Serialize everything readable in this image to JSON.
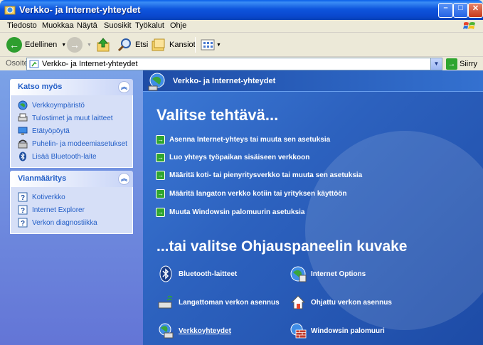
{
  "window": {
    "title": "Verkko- ja Internet-yhteydet"
  },
  "menu": [
    "Tiedosto",
    "Muokkaa",
    "Näytä",
    "Suosikit",
    "Työkalut",
    "Ohje"
  ],
  "toolbar": {
    "back_label": "Edellinen",
    "search_label": "Etsi",
    "folders_label": "Kansiot"
  },
  "address": {
    "label": "Osoite",
    "value": "Verkko- ja Internet-yhteydet",
    "go_label": "Siirry"
  },
  "see_also": {
    "title": "Katso myös",
    "items": [
      "Verkkoympäristö",
      "Tulostimet ja muut laitteet",
      "Etätyöpöytä",
      "Puhelin- ja modeemiasetukset",
      "Lisää Bluetooth-laite"
    ]
  },
  "troubleshoot": {
    "title": "Vianmääritys",
    "items": [
      "Kotiverkko",
      "Internet Explorer",
      "Verkon diagnostiikka"
    ]
  },
  "main": {
    "header": "Verkko- ja Internet-yhteydet",
    "pick_task": "Valitse tehtävä...",
    "tasks": [
      "Asenna Internet-yhteys tai muuta sen asetuksia",
      "Luo yhteys työpaikan sisäiseen verkkoon",
      "Määritä koti- tai pienyritysverkko tai muuta sen asetuksia",
      "Määritä langaton verkko kotiin tai yrityksen käyttöön",
      "Muuta Windowsin palomuurin asetuksia"
    ],
    "pick_icon": "...tai valitse Ohjauspaneelin kuvake",
    "icons": [
      "Bluetooth-laitteet",
      "Internet Options",
      "Langattoman verkon asennus",
      "Ohjattu verkon asennus",
      "Verkkoyhteydet",
      "Windowsin palomuuri"
    ]
  },
  "colors": {
    "accent_blue": "#215dc6",
    "task_arrow": "#2fa52f",
    "title_bar": "#0a48cf"
  }
}
